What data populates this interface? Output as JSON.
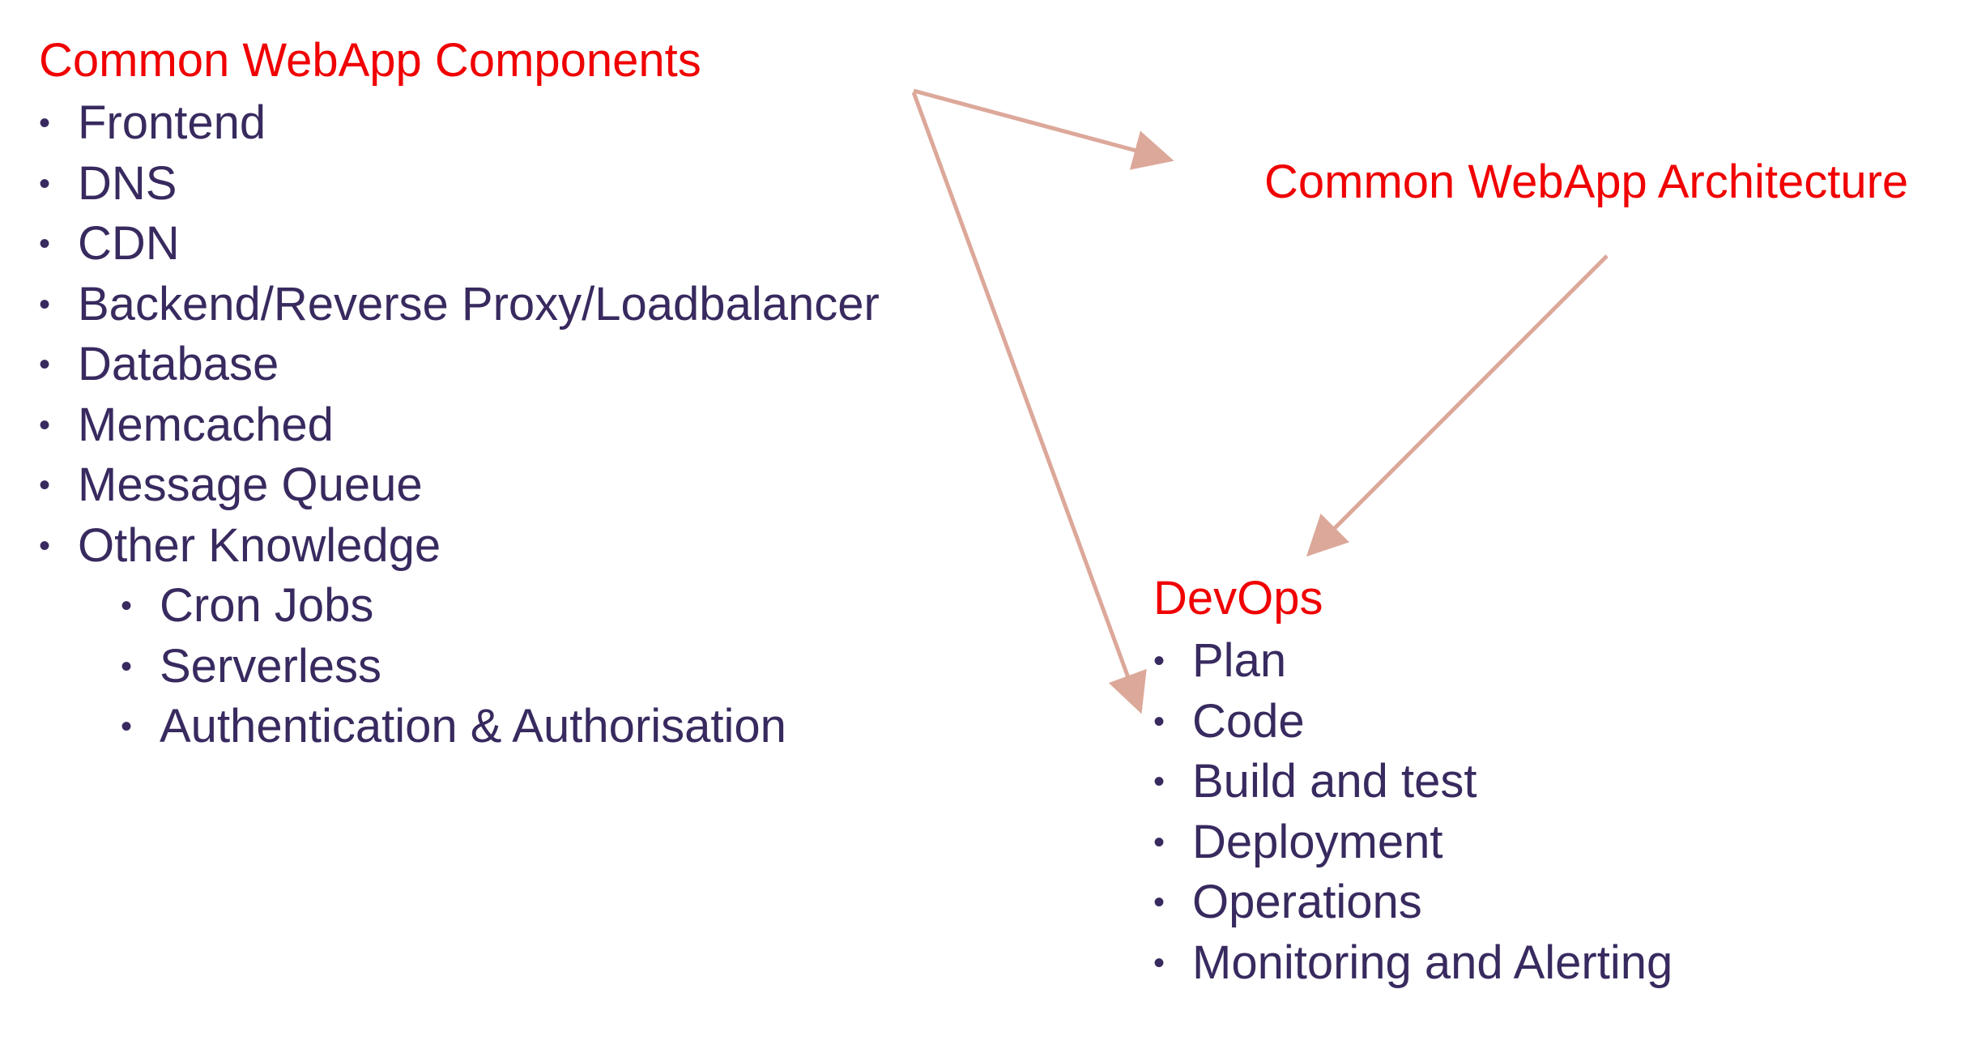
{
  "components": {
    "title": "Common WebApp Components",
    "items": [
      {
        "label": "Frontend",
        "level": 1
      },
      {
        "label": "DNS",
        "level": 1
      },
      {
        "label": "CDN",
        "level": 1
      },
      {
        "label": "Backend/Reverse Proxy/Loadbalancer",
        "level": 1
      },
      {
        "label": "Database",
        "level": 1
      },
      {
        "label": "Memcached",
        "level": 1
      },
      {
        "label": "Message Queue",
        "level": 1
      },
      {
        "label": "Other Knowledge",
        "level": 1
      },
      {
        "label": "Cron Jobs",
        "level": 2
      },
      {
        "label": "Serverless",
        "level": 2
      },
      {
        "label": "Authentication & Authorisation",
        "level": 2
      }
    ]
  },
  "architecture": {
    "title": "Common WebApp Architecture"
  },
  "devops": {
    "title": "DevOps",
    "items": [
      {
        "label": "Plan",
        "level": 1
      },
      {
        "label": "Code",
        "level": 1
      },
      {
        "label": "Build and test",
        "level": 1
      },
      {
        "label": "Deployment",
        "level": 1
      },
      {
        "label": "Operations",
        "level": 1
      },
      {
        "label": "Monitoring and Alerting",
        "level": 1
      }
    ]
  },
  "bullet_glyph": "•",
  "colors": {
    "heading": "#f00000",
    "text": "#382a5f",
    "arrow": "#dca89a"
  }
}
